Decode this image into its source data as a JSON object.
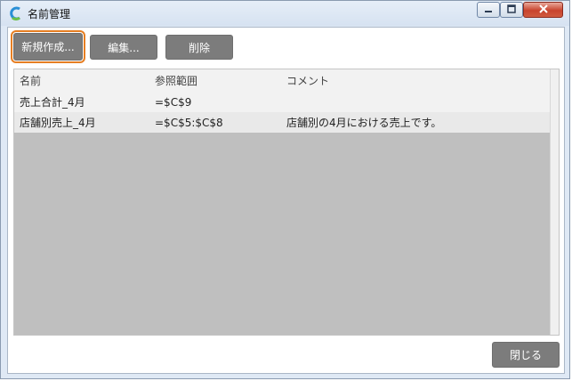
{
  "window": {
    "title": "名前管理",
    "icons": {
      "app": "app-logo-icon",
      "minimize": "minimize-icon",
      "maximize": "maximize-icon",
      "close": "close-icon"
    },
    "close_color": "#c8432d"
  },
  "toolbar": {
    "new_label": "新規作成...",
    "edit_label": "編集...",
    "delete_label": "削除",
    "focus_color": "#e67e22",
    "button_color": "#7c7c7c"
  },
  "grid": {
    "columns": [
      "名前",
      "参照範囲",
      "コメント"
    ],
    "rows": [
      {
        "name": "売上合計_4月",
        "ref": "=$C$9",
        "comment": ""
      },
      {
        "name": "店舗別売上_4月",
        "ref": "=$C$5:$C$8",
        "comment": "店舗別の4月における売上です。"
      }
    ]
  },
  "footer": {
    "close_label": "閉じる"
  }
}
